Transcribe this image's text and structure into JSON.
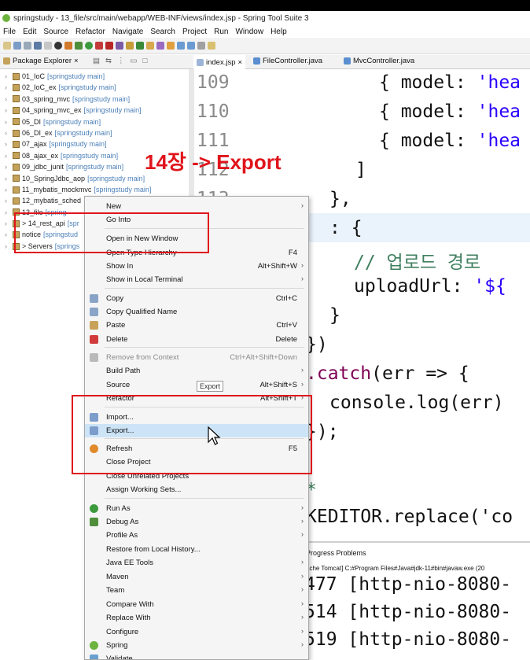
{
  "window": {
    "title": "springstudy - 13_file/src/main/webapp/WEB-INF/views/index.jsp - Spring Tool Suite 3"
  },
  "menubar": [
    "File",
    "Edit",
    "Source",
    "Refactor",
    "Navigate",
    "Search",
    "Project",
    "Run",
    "Window",
    "Help"
  ],
  "explorer": {
    "title": "Package Explorer",
    "close": "×"
  },
  "editor_tabs": [
    "index.jsp",
    "FileController.java",
    "MvcController.java"
  ],
  "tree": [
    {
      "name": "01_IoC",
      "tag": "[springstudy main]"
    },
    {
      "name": "02_IoC_ex",
      "tag": "[springstudy main]"
    },
    {
      "name": "03_spring_mvc",
      "tag": "[springstudy main]"
    },
    {
      "name": "04_spring_mvc_ex",
      "tag": "[springstudy main]"
    },
    {
      "name": "05_DI",
      "tag": "[springstudy main]"
    },
    {
      "name": "06_DI_ex",
      "tag": "[springstudy main]"
    },
    {
      "name": "07_ajax",
      "tag": "[springstudy main]"
    },
    {
      "name": "08_ajax_ex",
      "tag": "[springstudy main]"
    },
    {
      "name": "09_jdbc_junit",
      "tag": "[springstudy main]"
    },
    {
      "name": "10_SpringJdbc_aop",
      "tag": "[springstudy main]"
    },
    {
      "name": "11_mybatis_mockmvc",
      "tag": "[springstudy main]"
    },
    {
      "name": "12_mybatis_sched",
      "tag": ""
    },
    {
      "name": "13_file",
      "tag": "[spring"
    },
    {
      "name": "> 14_rest_api",
      "tag": "[spr"
    },
    {
      "name": "notice",
      "tag": "[springstud"
    },
    {
      "name": "> Servers",
      "tag": "[springs"
    }
  ],
  "annotation": "14장 -> Export",
  "tooltip": "Export",
  "code": {
    "line_numbers": [
      "109",
      "110",
      "111",
      "112",
      "113"
    ],
    "l1_a": "{ model: ",
    "l1_b": "'hea",
    "l2_a": "{ model: ",
    "l2_b": "'hea",
    "l3_a": "{ model: ",
    "l3_b": "'hea",
    "l4": "]",
    "l5": "},",
    "l6": ": {",
    "l7": "// 업로드 경로",
    "l8_a": "uploadUrl: ",
    "l8_b": "'${",
    "l9": "}",
    "l10": "})",
    "l11_a": ".catch",
    "l11_b": "(err => {",
    "l12": "console.log(err)",
    "l13": "});",
    "l14": "*",
    "l15": "KEDITOR.replace('co"
  },
  "console": {
    "tabs": "Progress   Problems",
    "path": "ache Tomcat] C:#Program Files#Java#jdk-11#bin#javaw.exe (20",
    "lines": [
      "477 [http-nio-8080-",
      "514 [http-nio-8080-",
      "519 [http-nio-8080-"
    ]
  },
  "menu": [
    {
      "label": "New",
      "shortcut": "",
      "submenu": true,
      "dis": false
    },
    {
      "label": "Go Into",
      "shortcut": "",
      "submenu": false,
      "dis": false
    },
    {
      "label": "Open in New Window",
      "shortcut": "",
      "submenu": false,
      "dis": false
    },
    {
      "label": "Open Type Hierarchy",
      "shortcut": "F4",
      "submenu": false,
      "dis": false
    },
    {
      "label": "Show In",
      "shortcut": "Alt+Shift+W",
      "submenu": true,
      "dis": false
    },
    {
      "label": "Show in Local Terminal",
      "shortcut": "",
      "submenu": true,
      "dis": false
    },
    {
      "label": "Copy",
      "shortcut": "Ctrl+C",
      "submenu": false,
      "dis": false
    },
    {
      "label": "Copy Qualified Name",
      "shortcut": "",
      "submenu": false,
      "dis": false
    },
    {
      "label": "Paste",
      "shortcut": "Ctrl+V",
      "submenu": false,
      "dis": false
    },
    {
      "label": "Delete",
      "shortcut": "Delete",
      "submenu": false,
      "dis": false
    },
    {
      "label": "Remove from Context",
      "shortcut": "Ctrl+Alt+Shift+Down",
      "submenu": false,
      "dis": true
    },
    {
      "label": "Build Path",
      "shortcut": "",
      "submenu": true,
      "dis": false
    },
    {
      "label": "Source",
      "shortcut": "Alt+Shift+S",
      "submenu": true,
      "dis": false
    },
    {
      "label": "Refactor",
      "shortcut": "Alt+Shift+T",
      "submenu": true,
      "dis": false
    },
    {
      "label": "Import...",
      "shortcut": "",
      "submenu": false,
      "dis": false
    },
    {
      "label": "Export...",
      "shortcut": "",
      "submenu": false,
      "dis": false
    },
    {
      "label": "Refresh",
      "shortcut": "F5",
      "submenu": false,
      "dis": false
    },
    {
      "label": "Close Project",
      "shortcut": "",
      "submenu": false,
      "dis": false
    },
    {
      "label": "Close Unrelated Projects",
      "shortcut": "",
      "submenu": false,
      "dis": false
    },
    {
      "label": "Assign Working Sets...",
      "shortcut": "",
      "submenu": false,
      "dis": false
    },
    {
      "label": "Run As",
      "shortcut": "",
      "submenu": true,
      "dis": false
    },
    {
      "label": "Debug As",
      "shortcut": "",
      "submenu": true,
      "dis": false
    },
    {
      "label": "Profile As",
      "shortcut": "",
      "submenu": true,
      "dis": false
    },
    {
      "label": "Restore from Local History...",
      "shortcut": "",
      "submenu": false,
      "dis": false
    },
    {
      "label": "Java EE Tools",
      "shortcut": "",
      "submenu": true,
      "dis": false
    },
    {
      "label": "Maven",
      "shortcut": "",
      "submenu": true,
      "dis": false
    },
    {
      "label": "Team",
      "shortcut": "",
      "submenu": true,
      "dis": false
    },
    {
      "label": "Compare With",
      "shortcut": "",
      "submenu": true,
      "dis": false
    },
    {
      "label": "Replace With",
      "shortcut": "",
      "submenu": true,
      "dis": false
    },
    {
      "label": "Configure",
      "shortcut": "",
      "submenu": true,
      "dis": false
    },
    {
      "label": "Spring",
      "shortcut": "",
      "submenu": true,
      "dis": false
    },
    {
      "label": "Validate",
      "shortcut": "",
      "submenu": false,
      "dis": false
    }
  ],
  "colors": {
    "accent_red": "#e0141b",
    "selection": "#cde4f7",
    "string": "#2a00ff",
    "comment": "#3f7f5f",
    "keyword": "#7f0055"
  }
}
